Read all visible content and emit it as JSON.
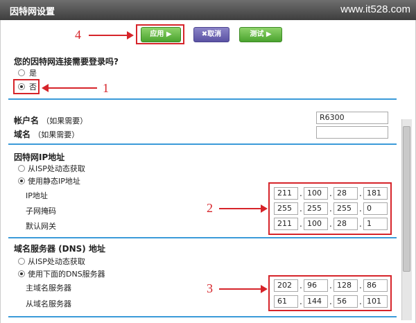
{
  "window": {
    "title": "因特网设置",
    "watermark": "www.it528.com"
  },
  "toolbar": {
    "apply_label": "应用 ▶",
    "cancel_label": "✖取消",
    "test_label": "测试 ▶"
  },
  "login_question": {
    "label": "您的因特网连接需要登录吗?",
    "options": [
      "是",
      "否"
    ],
    "selected": "否"
  },
  "account": {
    "username_label": "帐户名",
    "username_hint": "（如果需要）",
    "username_value": "R6300",
    "domain_label": "域名",
    "domain_hint": "（如果需要）",
    "domain_value": ""
  },
  "internet_ip": {
    "title": "因特网IP地址",
    "options": [
      "从ISP处动态获取",
      "使用静态IP地址"
    ],
    "selected": "使用静态IP地址",
    "ip_label": "IP地址",
    "ip": [
      "211",
      "100",
      "28",
      "181"
    ],
    "mask_label": "子网掩码",
    "mask": [
      "255",
      "255",
      "255",
      "0"
    ],
    "gateway_label": "默认网关",
    "gateway": [
      "211",
      "100",
      "28",
      "1"
    ]
  },
  "dns": {
    "title": "域名服务器 (DNS) 地址",
    "options": [
      "从ISP处动态获取",
      "使用下面的DNS服务器"
    ],
    "selected": "使用下面的DNS服务器",
    "primary_label": "主域名服务器",
    "primary": [
      "202",
      "96",
      "128",
      "86"
    ],
    "secondary_label": "从域名服务器",
    "secondary": [
      "61",
      "144",
      "56",
      "101"
    ]
  },
  "annotations": {
    "a1": "1",
    "a2": "2",
    "a3": "3",
    "a4": "4"
  },
  "colors": {
    "accent": "#3a9ad9",
    "annotation": "#d6242a",
    "apply": "#4aa32e",
    "cancel": "#5a52a3"
  }
}
